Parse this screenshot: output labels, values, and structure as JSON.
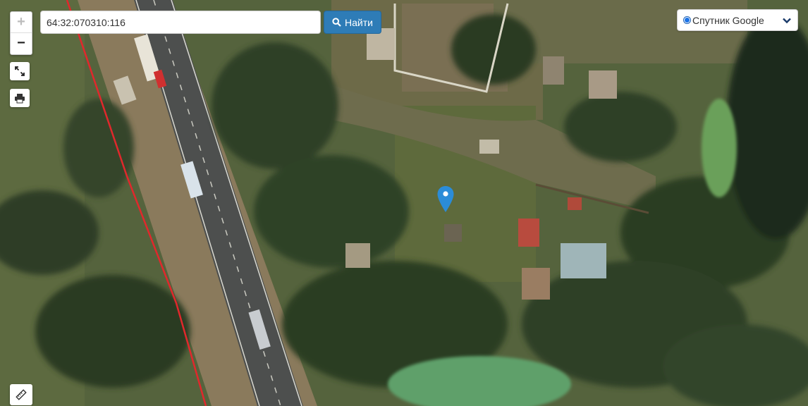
{
  "search": {
    "value": "64:32:070310:116",
    "button_label": "Найти",
    "button_icon": "search-icon"
  },
  "zoom": {
    "in_label": "+",
    "out_label": "−",
    "in_enabled": false
  },
  "tools": {
    "fullscreen_icon": "expand-icon",
    "print_icon": "printer-icon",
    "ruler_icon": "ruler-icon"
  },
  "layer": {
    "selected": "Спутник Google",
    "icon": "chevron-down-icon"
  },
  "marker": {
    "icon": "map-pin-icon",
    "color": "#2b8cd8"
  },
  "colors": {
    "search_button": "#2e7cb7",
    "parcel_line": "#e0282c"
  }
}
